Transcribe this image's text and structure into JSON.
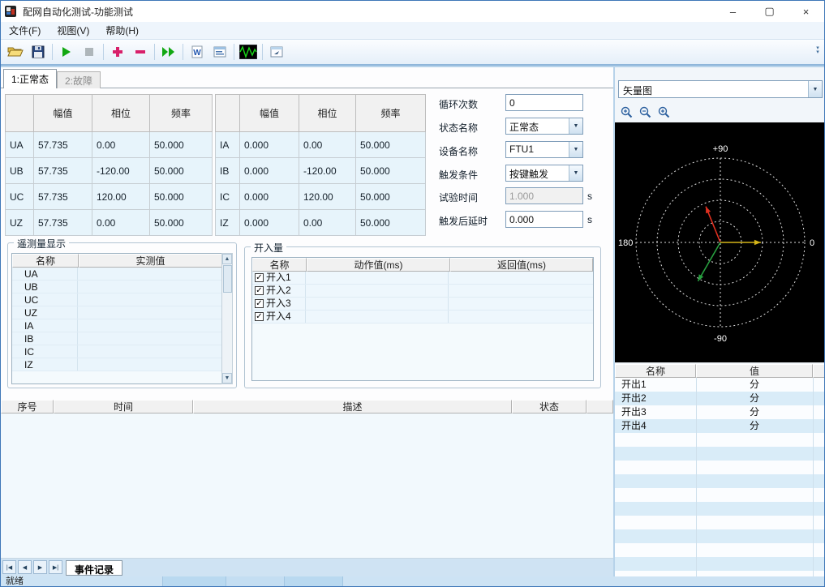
{
  "window": {
    "title": "配网自动化测试-功能测试"
  },
  "menu": {
    "items": [
      {
        "label": "文件(F)"
      },
      {
        "label": "视图(V)"
      },
      {
        "label": "帮助(H)"
      }
    ]
  },
  "toolbar": {
    "icons": [
      "open",
      "save",
      "start",
      "stop",
      "add",
      "remove",
      "start-all",
      "export-word",
      "report",
      "waveform",
      "view-window"
    ]
  },
  "tabs": [
    {
      "label": "1:正常态",
      "active": true
    },
    {
      "label": "2:故障",
      "active": false
    }
  ],
  "voltage_table": {
    "col_headers": [
      "幅值",
      "相位",
      "频率"
    ],
    "rows": [
      {
        "name": "UA",
        "amplitude": "57.735",
        "phase": "0.00",
        "frequency": "50.000"
      },
      {
        "name": "UB",
        "amplitude": "57.735",
        "phase": "-120.00",
        "frequency": "50.000"
      },
      {
        "name": "UC",
        "amplitude": "57.735",
        "phase": "120.00",
        "frequency": "50.000"
      },
      {
        "name": "UZ",
        "amplitude": "57.735",
        "phase": "0.00",
        "frequency": "50.000"
      }
    ]
  },
  "current_table": {
    "col_headers": [
      "幅值",
      "相位",
      "频率"
    ],
    "rows": [
      {
        "name": "IA",
        "amplitude": "0.000",
        "phase": "0.00",
        "frequency": "50.000"
      },
      {
        "name": "IB",
        "amplitude": "0.000",
        "phase": "-120.00",
        "frequency": "50.000"
      },
      {
        "name": "IC",
        "amplitude": "0.000",
        "phase": "120.00",
        "frequency": "50.000"
      },
      {
        "name": "IZ",
        "amplitude": "0.000",
        "phase": "0.00",
        "frequency": "50.000"
      }
    ]
  },
  "settings": {
    "cycle_count": {
      "label": "循环次数",
      "value": "0"
    },
    "state_name": {
      "label": "状态名称",
      "value": "正常态"
    },
    "device_name": {
      "label": "设备名称",
      "value": "FTU1"
    },
    "trigger_condition": {
      "label": "触发条件",
      "value": "按键触发"
    },
    "test_time": {
      "label": "试验时间",
      "value": "1.000",
      "unit": "s"
    },
    "trigger_delay": {
      "label": "触发后延时",
      "value": "0.000",
      "unit": "s"
    }
  },
  "telemetry": {
    "title": "遥测量显示",
    "headers": [
      "名称",
      "实测值"
    ],
    "rows": [
      {
        "name": "UA",
        "value": ""
      },
      {
        "name": "UB",
        "value": ""
      },
      {
        "name": "UC",
        "value": ""
      },
      {
        "name": "UZ",
        "value": ""
      },
      {
        "name": "IA",
        "value": ""
      },
      {
        "name": "IB",
        "value": ""
      },
      {
        "name": "IC",
        "value": ""
      },
      {
        "name": "IZ",
        "value": ""
      }
    ]
  },
  "digital_inputs": {
    "title": "开入量",
    "headers": [
      "名称",
      "动作值(ms)",
      "返回值(ms)"
    ],
    "rows": [
      {
        "label": "开入1",
        "checked": true,
        "action": "",
        "return": ""
      },
      {
        "label": "开入2",
        "checked": true,
        "action": "",
        "return": ""
      },
      {
        "label": "开入3",
        "checked": true,
        "action": "",
        "return": ""
      },
      {
        "label": "开入4",
        "checked": true,
        "action": "",
        "return": ""
      }
    ]
  },
  "event_log": {
    "headers": [
      "序号",
      "时间",
      "描述",
      "状态"
    ],
    "rows": [],
    "tab_label": "事件记录"
  },
  "vector_panel": {
    "view_selector": "矢量图",
    "axis_labels": {
      "top": "+90",
      "left": "180",
      "right": "0",
      "bottom": "-90"
    },
    "vectors": [
      {
        "name": "phase-a",
        "color": "#e03020",
        "angle_deg": 112,
        "magnitude": 0.46
      },
      {
        "name": "phase-b",
        "color": "#d4b418",
        "angle_deg": 0,
        "magnitude": 0.48
      },
      {
        "name": "phase-c",
        "color": "#28a040",
        "angle_deg": 240,
        "magnitude": 0.53
      }
    ],
    "output_table": {
      "headers": [
        "名称",
        "值"
      ],
      "rows": [
        {
          "name": "开出1",
          "value": "分"
        },
        {
          "name": "开出2",
          "value": "分"
        },
        {
          "name": "开出3",
          "value": "分"
        },
        {
          "name": "开出4",
          "value": "分"
        }
      ]
    }
  },
  "status_bar": {
    "text": "就绪"
  }
}
